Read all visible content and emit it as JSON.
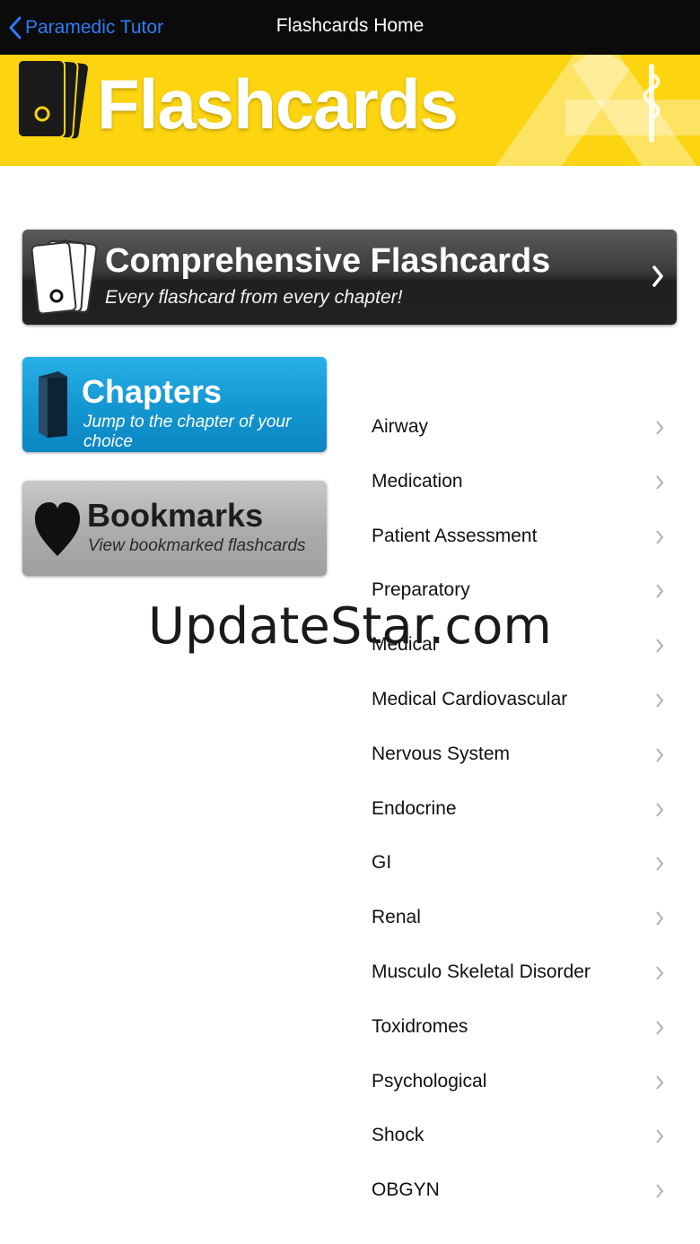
{
  "nav": {
    "back_label": "Paramedic Tutor",
    "title": "Flashcards Home"
  },
  "banner": {
    "title": "Flashcards",
    "icons": [
      "flashcards-icon",
      "star-of-life-staff-icon"
    ]
  },
  "comprehensive": {
    "title": "Comprehensive Flashcards",
    "subtitle": "Every flashcard from every chapter!"
  },
  "chapters_button": {
    "title": "Chapters",
    "subtitle": "Jump to the chapter of your choice"
  },
  "bookmarks_button": {
    "title": "Bookmarks",
    "subtitle": "View bookmarked flashcards"
  },
  "chapters": [
    {
      "label": "Airway"
    },
    {
      "label": "Medication"
    },
    {
      "label": "Patient Assessment"
    },
    {
      "label": "Preparatory"
    },
    {
      "label": "Medical"
    },
    {
      "label": "Medical Cardiovascular"
    },
    {
      "label": "Nervous System"
    },
    {
      "label": "Endocrine"
    },
    {
      "label": "GI"
    },
    {
      "label": "Renal"
    },
    {
      "label": "Musculo Skeletal Disorder"
    },
    {
      "label": "Toxidromes"
    },
    {
      "label": "Psychological"
    },
    {
      "label": "Shock"
    },
    {
      "label": "OBGYN"
    }
  ],
  "watermark": "UpdateStar.com",
  "colors": {
    "nav_bg": "#0b0b0b",
    "back_link": "#2f7cf6",
    "banner": "#fcd40f",
    "chapters_blue": "#1598d2",
    "bookmarks_gray": "#adadad",
    "comprehensive_dark": "#2b2b2b"
  }
}
